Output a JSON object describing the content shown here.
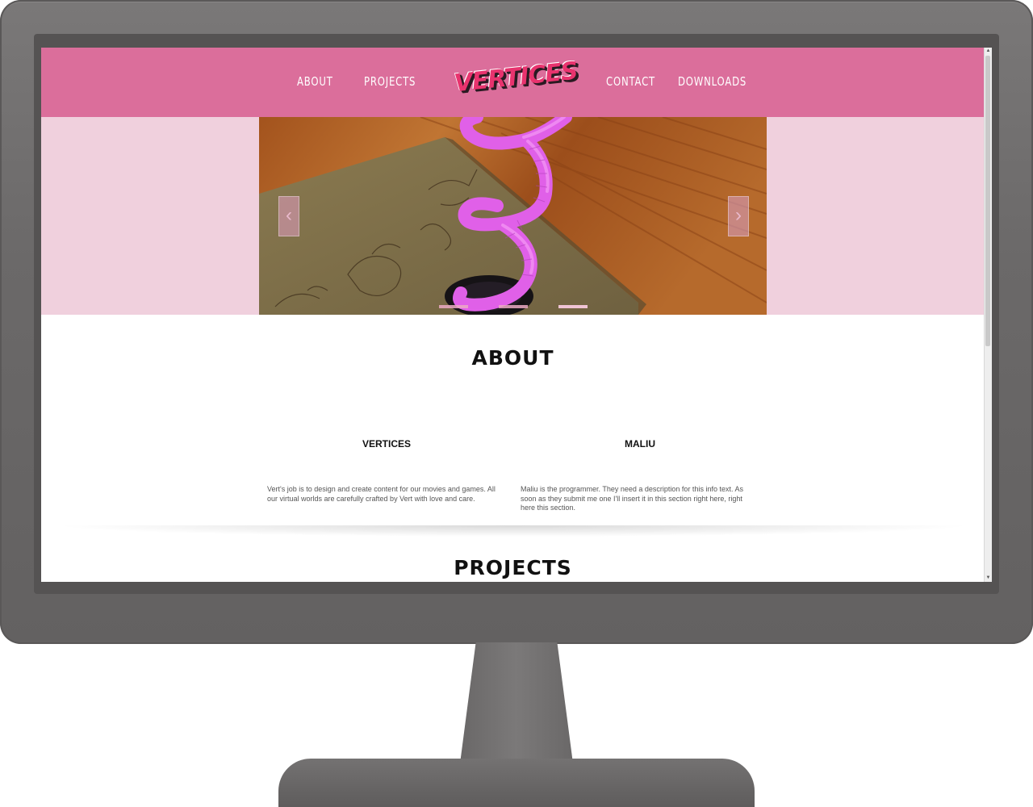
{
  "nav": {
    "links": [
      "ABOUT",
      "PROJECTS",
      "CONTACT",
      "DOWNLOADS"
    ],
    "logo_text": "VERTICES"
  },
  "carousel": {
    "prev_glyph": "‹",
    "next_glyph": "›",
    "slide_count": 3,
    "active_slide": 3
  },
  "about": {
    "title": "ABOUT",
    "members": [
      {
        "name": "VERTICES",
        "description": "Vert's job is to design and create content for our movies and games. All our virtual worlds are carefully crafted by Vert with love and care."
      },
      {
        "name": "MALIU",
        "description": "Maliu is the programmer. They need a description for this info text. As soon as they submit me one I'll insert it in this section right here, right here this section."
      }
    ]
  },
  "projects": {
    "title": "PROJECTS"
  },
  "colors": {
    "nav_bg": "#db6e9b",
    "hero_bg": "#f0d0dd",
    "logo": "#e8336e",
    "coil": "#e060e8"
  }
}
